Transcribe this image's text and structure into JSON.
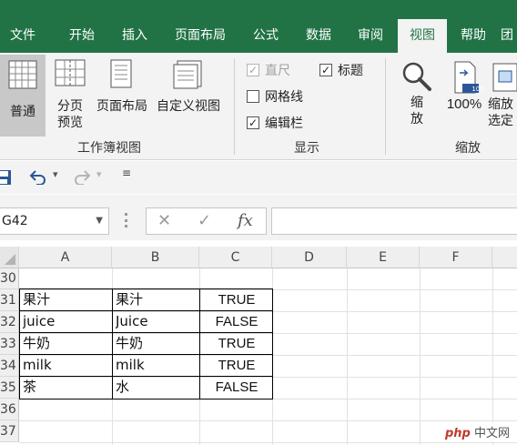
{
  "ribbon_tabs": [
    "文件",
    "开始",
    "插入",
    "页面布局",
    "公式",
    "数据",
    "审阅",
    "视图",
    "帮助",
    "团"
  ],
  "active_tab_index": 7,
  "workbook_views": {
    "normal": "普通",
    "page_break_line1": "分页",
    "page_break_line2": "预览",
    "page_layout": "页面布局",
    "custom_views": "自定义视图",
    "group_label": "工作簿视图"
  },
  "show": {
    "ruler": "直尺",
    "formula_bar": "编辑栏",
    "gridlines": "网格线",
    "headings": "标题",
    "ruler_checked": true,
    "formula_bar_checked": true,
    "gridlines_checked": false,
    "headings_checked": true,
    "group_label": "显示"
  },
  "zoom": {
    "zoom_line1": "缩",
    "zoom_line2": "放",
    "hundred": "100%",
    "badge": "100",
    "selection_line1": "缩放",
    "selection_line2": "选定",
    "group_label": "缩放"
  },
  "qat": {
    "more": "▾"
  },
  "formula_bar": {
    "name_box": "G42",
    "cancel": "✕",
    "enter": "✓",
    "fx": "fx",
    "value": ""
  },
  "columns": [
    "A",
    "B",
    "C",
    "D",
    "E",
    "F"
  ],
  "rows": [
    {
      "num": "30",
      "a": "",
      "b": "",
      "c": ""
    },
    {
      "num": "31",
      "a": "果汁",
      "b": "果汁",
      "c": "TRUE"
    },
    {
      "num": "32",
      "a": "juice",
      "b": "Juice",
      "c": "FALSE"
    },
    {
      "num": "33",
      "a": "牛奶",
      "b": "牛奶",
      "c": "TRUE"
    },
    {
      "num": "34",
      "a": "milk",
      "b": "milk",
      "c": "TRUE"
    },
    {
      "num": "35",
      "a": "茶",
      "b": "水",
      "c": "FALSE"
    },
    {
      "num": "36",
      "a": "",
      "b": "",
      "c": ""
    },
    {
      "num": "37",
      "a": "",
      "b": "",
      "c": ""
    }
  ],
  "watermark": {
    "php": "php",
    "site": "中文网"
  },
  "colors": {
    "excel_green": "#217346",
    "ribbon_bg": "#f3f3f3",
    "undo_blue": "#2b579a"
  }
}
